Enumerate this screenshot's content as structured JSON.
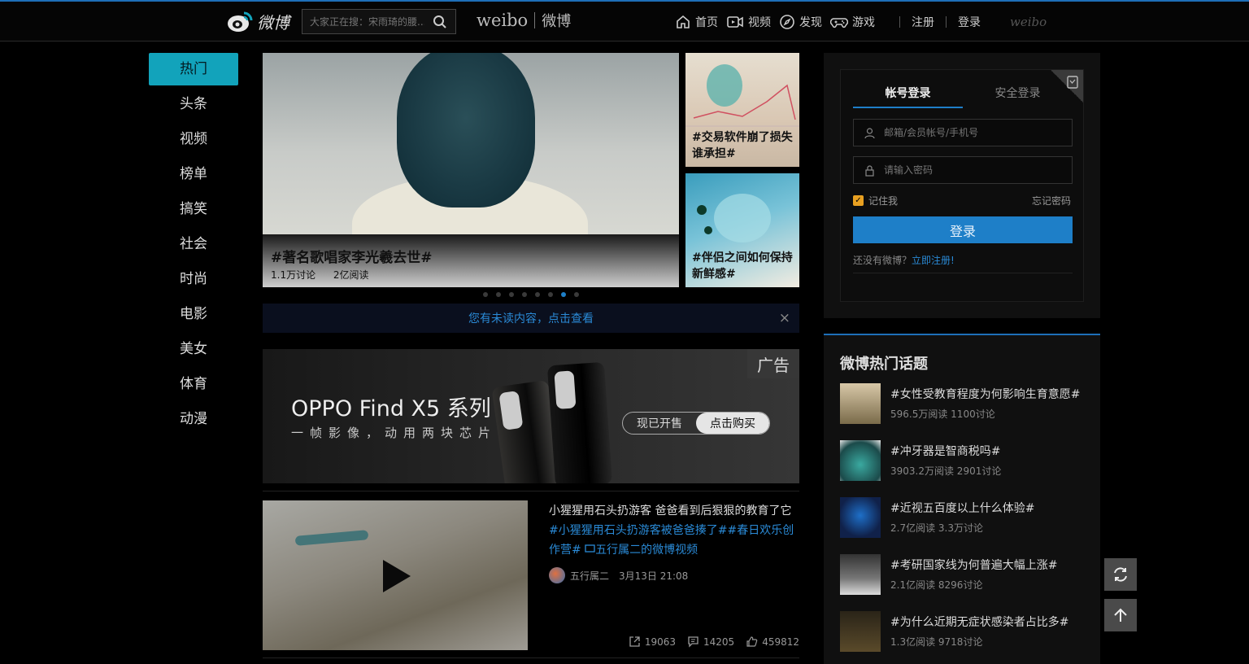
{
  "header": {
    "logo_text": "微博",
    "search_placeholder": "大家正在搜：宋雨琦的腰...",
    "brand_en": "weibo",
    "brand_cn": "微博",
    "nav": [
      {
        "label": "首页",
        "icon": "home-icon"
      },
      {
        "label": "视频",
        "icon": "video-icon"
      },
      {
        "label": "发现",
        "icon": "compass-icon"
      },
      {
        "label": "游戏",
        "icon": "gamepad-icon"
      }
    ],
    "register": "注册",
    "login": "登录",
    "watermark": "weibo"
  },
  "sidebar": {
    "items": [
      {
        "label": "热门",
        "active": true
      },
      {
        "label": "头条"
      },
      {
        "label": "视频"
      },
      {
        "label": "榜单"
      },
      {
        "label": "搞笑"
      },
      {
        "label": "社会"
      },
      {
        "label": "时尚"
      },
      {
        "label": "电影"
      },
      {
        "label": "美女"
      },
      {
        "label": "体育"
      },
      {
        "label": "动漫"
      }
    ]
  },
  "carousel": {
    "main_title": "#著名歌唱家李光羲去世#",
    "main_discuss": "1.1万讨论",
    "main_read": "2亿阅读",
    "side1_title": "#交易软件崩了损失谁承担#",
    "side2_title": "#伴侣之间如何保持新鲜感#",
    "active_dot": 6,
    "dot_count": 8
  },
  "notice": {
    "text": "您有未读内容，点击查看",
    "close": "×"
  },
  "ad": {
    "tag": "广告",
    "title": "OPPO Find X5 系列",
    "subtitle": "一帧影像，动用两块芯片",
    "btn_onsale": "现已开售",
    "btn_buy": "点击购买"
  },
  "feed": {
    "text": "小猩猩用石头扔游客 爸爸看到后狠狠的教育了它",
    "tags": "#小猩猩用石头扔游客被爸爸揍了##春日欢乐创作营# ",
    "video_link": "五行属二的微博视频",
    "author": "五行属二",
    "time": "3月13日 21:08",
    "reposts": "19063",
    "comments": "14205",
    "likes": "459812"
  },
  "login": {
    "tab_account": "帐号登录",
    "tab_secure": "安全登录",
    "user_placeholder": "邮箱/会员帐号/手机号",
    "pwd_placeholder": "请输入密码",
    "remember": "记住我",
    "forgot": "忘记密码",
    "submit": "登录",
    "no_account": "还没有微博？",
    "register_now": "立即注册!"
  },
  "topics": {
    "title": "微博热门话题",
    "items": [
      {
        "name": "#女性受教育程度为何影响生育意愿#",
        "meta": "596.5万阅读 1100讨论"
      },
      {
        "name": "#冲牙器是智商税吗#",
        "meta": "3903.2万阅读 2901讨论"
      },
      {
        "name": "#近视五百度以上什么体验#",
        "meta": "2.7亿阅读 3.3万讨论"
      },
      {
        "name": "#考研国家线为何普遍大幅上涨#",
        "meta": "2.1亿阅读 8296讨论"
      },
      {
        "name": "#为什么近期无症状感染者占比多#",
        "meta": "1.3亿阅读 9718讨论"
      }
    ]
  },
  "colors": {
    "accent_blue": "#1e7fc8",
    "sidebar_active": "#12a3bb",
    "checkbox": "#e8a021"
  }
}
